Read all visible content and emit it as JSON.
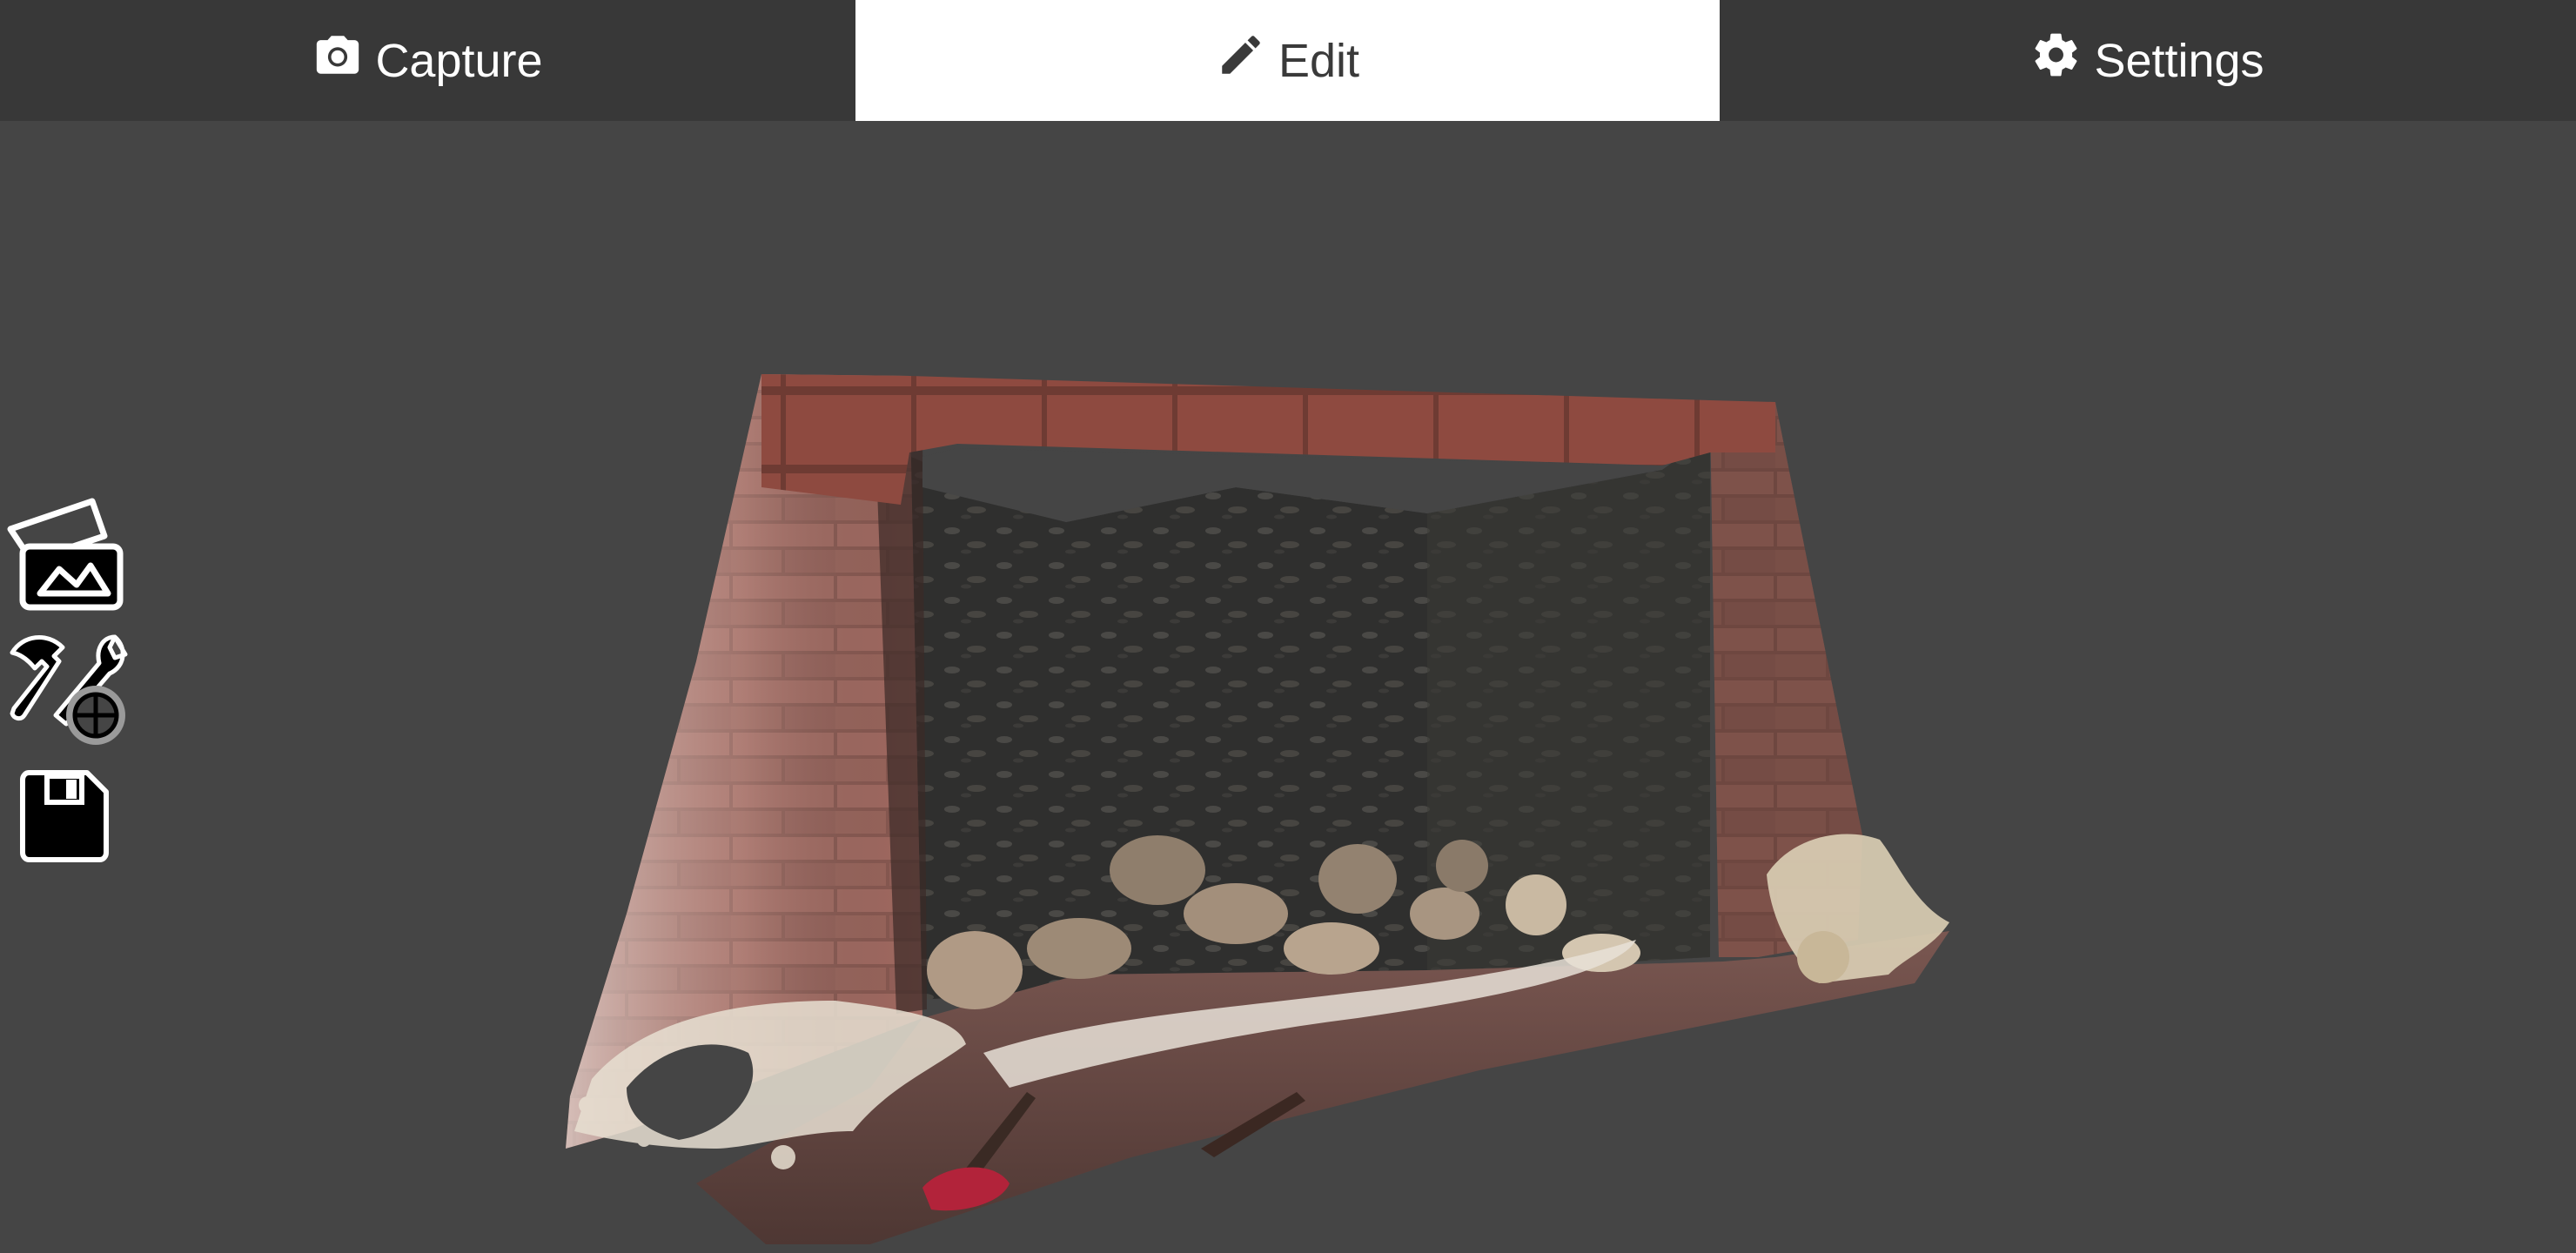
{
  "tabs": {
    "capture_label": "Capture",
    "edit_label": "Edit",
    "settings_label": "Settings",
    "active": "Edit"
  },
  "toolbar": {
    "gallery_icon": "gallery-icon",
    "tools_icon": "hammer-wrench-icon",
    "save_icon": "save-icon"
  },
  "colors": {
    "tabbar_bg": "#383838",
    "active_tab_bg": "#ffffff",
    "viewport_bg": "#454545"
  }
}
